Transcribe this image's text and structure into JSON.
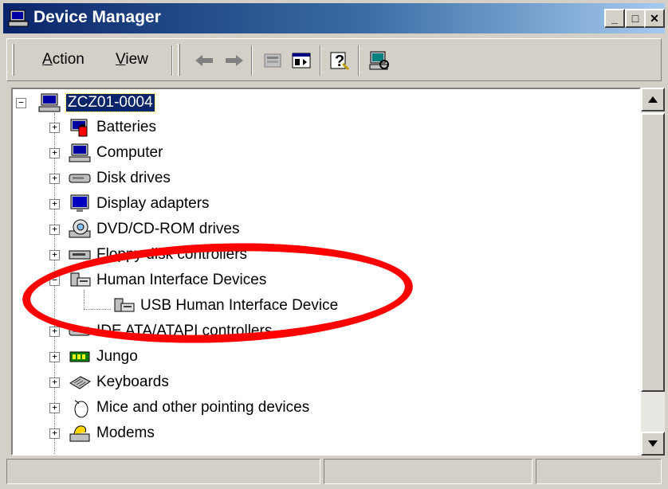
{
  "window": {
    "title": "Device Manager",
    "controls": {
      "minimize": "_",
      "maximize": "□",
      "close": "✕"
    }
  },
  "toolbar": {
    "menus": [
      {
        "label": "Action",
        "accel": "A"
      },
      {
        "label": "View",
        "accel": "V"
      }
    ],
    "icons": [
      "back-arrow-icon",
      "forward-arrow-icon",
      "properties-icon",
      "console-tree-icon",
      "help-icon",
      "scan-hardware-icon"
    ]
  },
  "tree": {
    "root": {
      "label": "ZCZ01-0004",
      "expander": "−"
    },
    "items": [
      {
        "label": "Batteries",
        "expander": "+",
        "icon": "battery-icon"
      },
      {
        "label": "Computer",
        "expander": "+",
        "icon": "computer-icon"
      },
      {
        "label": "Disk drives",
        "expander": "+",
        "icon": "disk-drive-icon"
      },
      {
        "label": "Display adapters",
        "expander": "+",
        "icon": "display-adapter-icon"
      },
      {
        "label": "DVD/CD-ROM drives",
        "expander": "+",
        "icon": "cdrom-icon"
      },
      {
        "label": "Floppy disk controllers",
        "expander": "+",
        "icon": "floppy-controller-icon"
      },
      {
        "label": "Human Interface Devices",
        "expander": "−",
        "icon": "hid-icon",
        "children": [
          {
            "label": "USB Human Interface Device",
            "icon": "hid-icon"
          }
        ]
      },
      {
        "label": "IDE ATA/ATAPI controllers",
        "expander": "+",
        "icon": "ide-controller-icon"
      },
      {
        "label": "Jungo",
        "expander": "+",
        "icon": "jungo-icon"
      },
      {
        "label": "Keyboards",
        "expander": "+",
        "icon": "keyboard-icon"
      },
      {
        "label": "Mice and other pointing devices",
        "expander": "+",
        "icon": "mouse-icon"
      },
      {
        "label": "Modems",
        "expander": "+",
        "icon": "modem-icon"
      }
    ]
  },
  "annotation": {
    "color": "#ff0000"
  },
  "colors": {
    "title_start": "#0a246a",
    "title_end": "#a6caf0",
    "selection": "#0a246a"
  }
}
